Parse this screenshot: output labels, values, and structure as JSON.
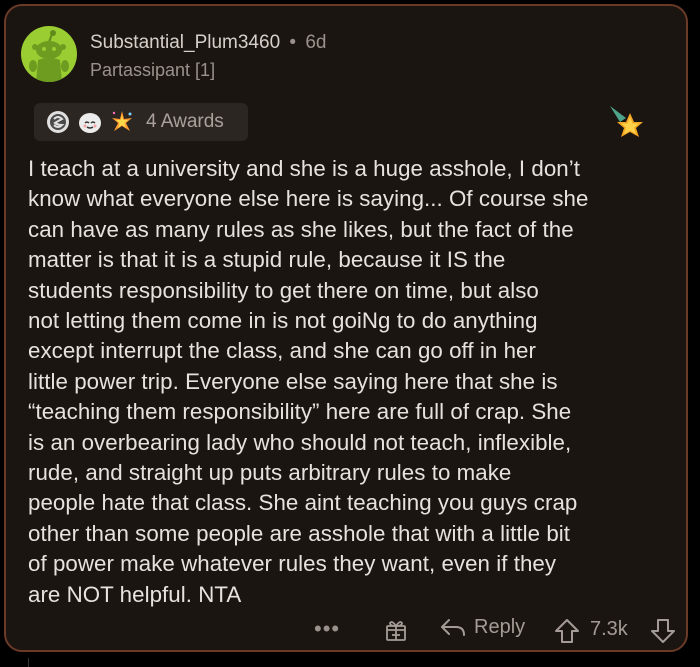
{
  "comment": {
    "username": "Substantial_Plum3460",
    "separator": "•",
    "age": "6d",
    "flair": "Partassipant [1]",
    "awards_label": "4 Awards",
    "body": "I teach at a university and she is a huge asshole, I don’t\nknow what everyone else here is saying... Of course she\ncan have as many rules as she likes, but the fact of the\nmatter is that it is a stupid rule, because it IS the\nstudents responsibility to get there on time, but also\nnot letting them come in is not goiNg to do anything\nexcept interrupt the class, and she can go off in her\nlittle power trip. Everyone else saying here that she is\n“teaching them responsibility” here are full of crap. She\nis an overbearing lady who should not teach, inflexible,\nrude, and straight up puts arbitrary rules to make\npeople hate that class. She aint teaching you guys crap\nother than some people are asshole that with a little bit\nof power make whatever rules they want, even if they\nare NOT helpful. NTA"
  },
  "actions": {
    "more_label": "•••",
    "reply_label": "Reply",
    "score": "7.3k"
  },
  "icons": {
    "avatar": "snoo-avatar-icon",
    "award_1": "silver-award-icon",
    "award_2": "wholesome-award-icon",
    "award_3": "starstruck-award-icon",
    "award_badge": "star-award-icon",
    "gift": "gift-icon",
    "reply": "reply-arrow-icon",
    "upvote": "upvote-arrow-icon",
    "downvote": "downvote-arrow-icon"
  },
  "colors": {
    "card_background": "#1b1511",
    "card_border": "#6a3a26",
    "avatar_background": "#9acd32",
    "text_primary": "#e8e2de",
    "text_muted": "#9a918c"
  }
}
